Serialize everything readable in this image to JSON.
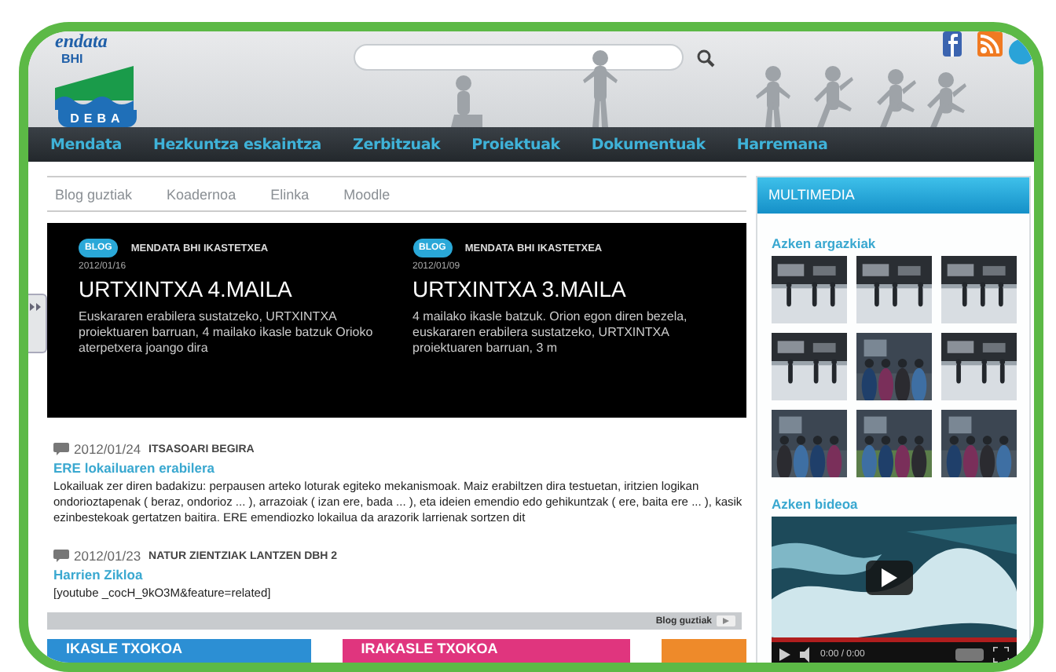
{
  "header": {
    "logo": {
      "name": "endata",
      "sub": "BHI",
      "place": "DEBA"
    }
  },
  "nav": [
    {
      "label": "Mendata"
    },
    {
      "label": "Hezkuntza eskaintza"
    },
    {
      "label": "Zerbitzuak"
    },
    {
      "label": "Proiektuak"
    },
    {
      "label": "Dokumentuak"
    },
    {
      "label": "Harremana"
    }
  ],
  "blog_tabs": [
    {
      "label": "Blog guztiak"
    },
    {
      "label": "Koadernoa"
    },
    {
      "label": "Elinka"
    },
    {
      "label": "Moodle"
    }
  ],
  "featured": [
    {
      "badge": "BLOG",
      "author": "MENDATA BHI IKASTETXEA",
      "date": "2012/01/16",
      "title": "URTXINTXA 4.MAILA",
      "text": "Euskararen erabilera sustatzeko, URTXINTXA proiektuaren barruan, 4 mailako ikasle batzuk Orioko aterpetxera joango dira"
    },
    {
      "badge": "BLOG",
      "author": "MENDATA BHI IKASTETXEA",
      "date": "2012/01/09",
      "title": "URTXINTXA 3.MAILA",
      "text": "4 mailako ikasle batzuk. Orion egon diren bezela, euskararen erabilera sustatzeko, URTXINTXA proiektuaren barruan, 3 m"
    }
  ],
  "posts": [
    {
      "date": "2012/01/24",
      "blog": "ITSASOARI BEGIRA",
      "title": "ERE lokailuaren erabilera",
      "text": "Lokailuak zer diren badakizu: perpausen arteko loturak egiteko mekanismoak. Maiz erabiltzen dira testuetan, iritzien logikan ondorioztapenak ( beraz, ondorioz ... ), arrazoiak ( izan ere, bada ... ), eta ideien emendio edo gehikuntzak ( ere, baita ere ... ), kasik ezinbestekoak gertatzen baitira. ERE emendiozko lokailua da arazorik larrienak sortzen dit"
    },
    {
      "date": "2012/01/23",
      "blog": "NATUR ZIENTZIAK LANTZEN DBH 2",
      "title": "Harrien Zikloa",
      "text": "[youtube _cocH_9kO3M&feature=related]"
    }
  ],
  "more_link": "Blog guztiak",
  "tiles": [
    {
      "label": "IKASLE TXOKOA",
      "color": "#2c8fd4"
    },
    {
      "label": "IRAKASLE TXOKOA",
      "color": "#e0357e"
    },
    {
      "color": "#ee8a2a"
    }
  ],
  "sidebar": {
    "title": "MULTIMEDIA",
    "photos_heading": "Azken argazkiak",
    "videos_heading": "Azken bideoa",
    "video": {
      "kind": "picture",
      "level": 1,
      "time": "0:00 / 0:00"
    }
  }
}
